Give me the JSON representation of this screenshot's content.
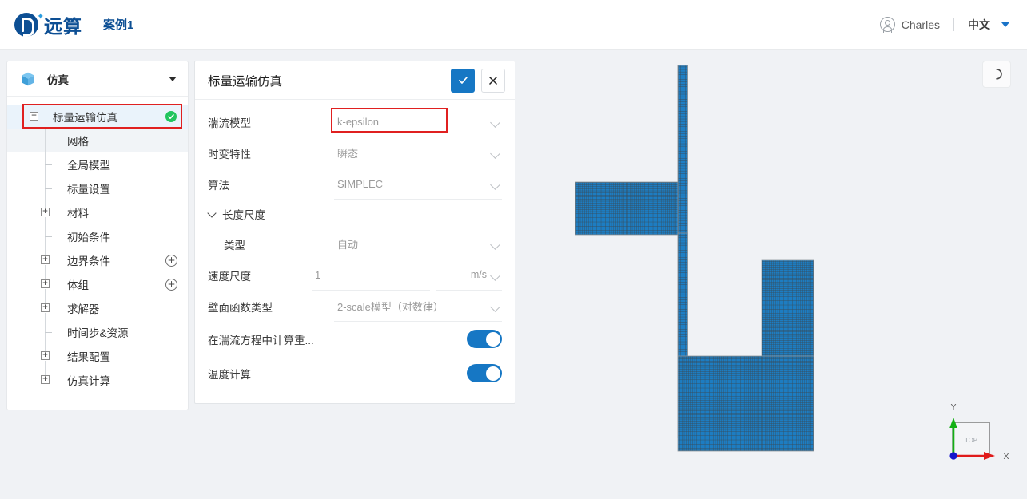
{
  "header": {
    "brand_name": "远算",
    "case_name": "案例1",
    "user_name": "Charles",
    "language": "中文",
    "logo_icon": "yuansuan-logo-icon",
    "user_icon": "user-avatar-icon",
    "caret_icon": "chevron-down-icon"
  },
  "sidebar": {
    "header_label": "仿真",
    "header_icon": "cube-icon",
    "header_caret_icon": "chevron-down-icon",
    "tree": [
      {
        "label": "标量运输仿真",
        "type": "branch",
        "state": "expanded",
        "depth": 0,
        "selected": true,
        "highlighted": true,
        "status": "ok",
        "status_icon": "check-circle-icon"
      },
      {
        "label": "网格",
        "type": "leaf",
        "depth": 1,
        "hovered": true
      },
      {
        "label": "全局模型",
        "type": "leaf",
        "depth": 1
      },
      {
        "label": "标量设置",
        "type": "leaf",
        "depth": 1
      },
      {
        "label": "材料",
        "type": "branch",
        "state": "collapsed",
        "depth": 0.5
      },
      {
        "label": "初始条件",
        "type": "leaf",
        "depth": 1
      },
      {
        "label": "边界条件",
        "type": "branch",
        "state": "collapsed",
        "depth": 0.5,
        "action": "add",
        "action_icon": "plus-circle-icon"
      },
      {
        "label": "体组",
        "type": "branch",
        "state": "collapsed",
        "depth": 0.5,
        "action": "add",
        "action_icon": "plus-circle-icon"
      },
      {
        "label": "求解器",
        "type": "branch",
        "state": "collapsed",
        "depth": 0.5
      },
      {
        "label": "时间步&资源",
        "type": "leaf",
        "depth": 1
      },
      {
        "label": "结果配置",
        "type": "branch",
        "state": "collapsed",
        "depth": 0.5
      },
      {
        "label": "仿真计算",
        "type": "branch",
        "state": "collapsed",
        "depth": 0.5
      }
    ]
  },
  "panel": {
    "title": "标量运输仿真",
    "confirm_icon": "check-icon",
    "cancel_icon": "close-icon",
    "rows": [
      {
        "kind": "select",
        "label": "湍流模型",
        "value": "k-epsilon",
        "highlighted": true,
        "caret_icon": "chevron-down-icon"
      },
      {
        "kind": "select",
        "label": "时变特性",
        "value": "瞬态",
        "caret_icon": "chevron-down-icon"
      },
      {
        "kind": "select",
        "label": "算法",
        "value": "SIMPLEC",
        "caret_icon": "chevron-down-icon"
      },
      {
        "kind": "group",
        "label": "长度尺度",
        "state": "expanded",
        "chevron_icon": "chevron-down-icon"
      },
      {
        "kind": "select",
        "label": "类型",
        "value": "自动",
        "indent": 1,
        "caret_icon": "chevron-down-icon"
      },
      {
        "kind": "number-unit",
        "label": "速度尺度",
        "value": "1",
        "unit": "m/s",
        "caret_icon": "chevron-down-icon"
      },
      {
        "kind": "select",
        "label": "壁面函数类型",
        "value": "2-scale模型（对数律）",
        "caret_icon": "chevron-down-icon"
      },
      {
        "kind": "toggle",
        "label": "在湍流方程中计算重...",
        "value": "on"
      },
      {
        "kind": "toggle",
        "label": "温度计算",
        "value": "on"
      }
    ]
  },
  "viewport": {
    "reset_button_icon": "reset-view-icon",
    "axis": {
      "x_label": "X",
      "y_label": "Y",
      "face_label": "TOP",
      "x_color": "#e01b1b",
      "y_color": "#13b013",
      "origin_color": "#1616cc"
    },
    "mesh": {
      "name": "scalar-transport-mesh",
      "fill_color": "#1f7fc4",
      "line_color": "#3d4a52",
      "background_color": "#f0f2f5"
    }
  },
  "colors": {
    "brand_blue": "#0d4f94",
    "accent_blue": "#1677c4",
    "highlight_red": "#e02020",
    "status_green": "#22c55e",
    "page_bg": "#f0f2f5"
  }
}
